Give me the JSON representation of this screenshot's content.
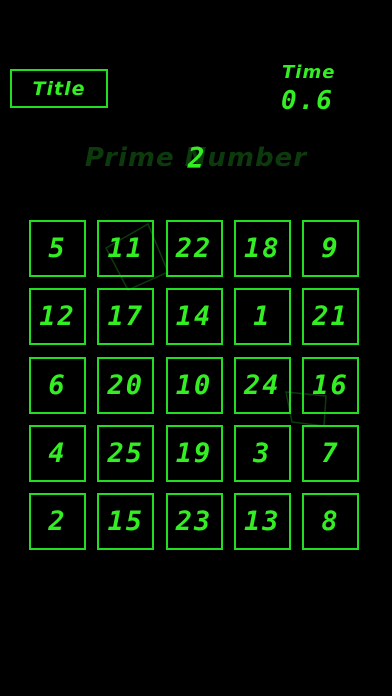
{
  "header": {
    "title_button": "Title",
    "time_label": "Time",
    "time_value": "0.6"
  },
  "game": {
    "mode_label": "Prime Number",
    "target_number": "2",
    "accent_color": "#33ee22",
    "grid": [
      [
        "5",
        "11",
        "22",
        "18",
        "9"
      ],
      [
        "12",
        "17",
        "14",
        "1",
        "21"
      ],
      [
        "6",
        "20",
        "10",
        "24",
        "16"
      ],
      [
        "4",
        "25",
        "19",
        "3",
        "7"
      ],
      [
        "2",
        "15",
        "23",
        "13",
        "8"
      ]
    ]
  }
}
